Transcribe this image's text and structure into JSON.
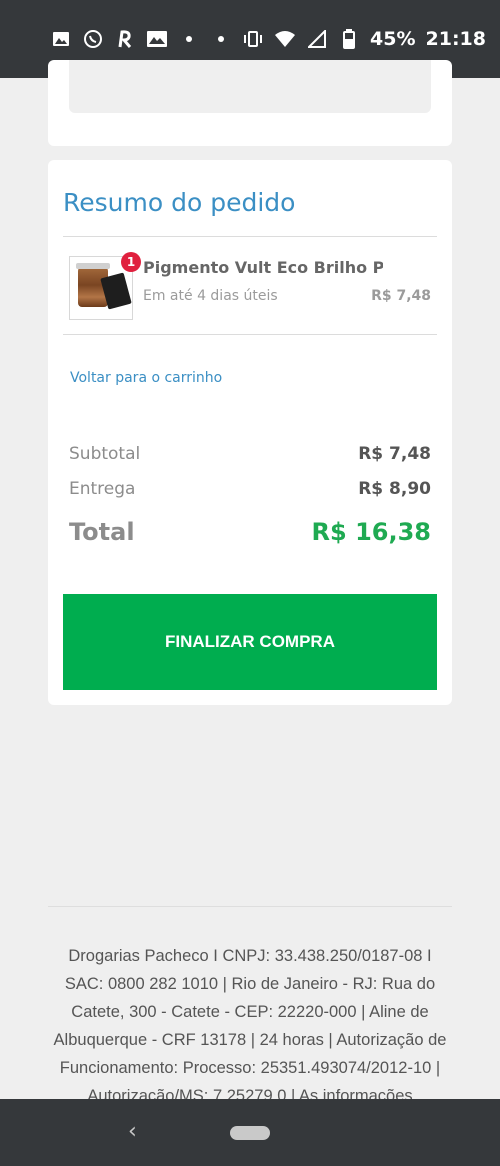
{
  "status_bar": {
    "battery": "45%",
    "time": "21:18"
  },
  "summary": {
    "title": "Resumo do pedido",
    "item": {
      "quantity": "1",
      "name": "Pigmento Vult Eco Brilho P...",
      "delivery": "Em até 4 dias úteis",
      "price": "R$ 7,48"
    },
    "back_link": "Voltar para o carrinho",
    "subtotal_label": "Subtotal",
    "subtotal_value": "R$ 7,48",
    "shipping_label": "Entrega",
    "shipping_value": "R$ 8,90",
    "total_label": "Total",
    "total_value": "R$ 16,38",
    "checkout_label": "FINALIZAR COMPRA"
  },
  "footer": {
    "text": "Drogarias Pacheco I CNPJ: 33.438.250/0187-08 I SAC: 0800 282 1010 | Rio de Janeiro - RJ: Rua do Catete, 300 - Catete - CEP: 22220-000 | Aline de Albuquerque - CRF 13178 | 24 horas | Autorização de Funcionamento: Processo: 25351.493074/2012-10 | Autorização/MS: 7.25279.0 | As informações"
  },
  "nav_bar": {
    "back_glyph": "‹"
  },
  "colors": {
    "accent_blue": "#3b8fc4",
    "total_green": "#1faa52",
    "button_green": "#00ad4f",
    "badge_red": "#e0203e"
  }
}
